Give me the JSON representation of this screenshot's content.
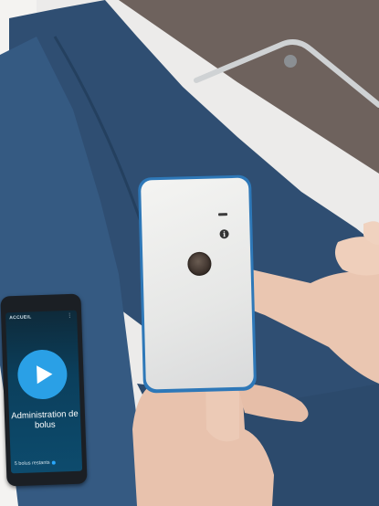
{
  "phone": {
    "header": "ACCUEIL",
    "menu_icon": "more-vertical-icon",
    "play_icon": "play-icon",
    "action_label": "Administration de bolus",
    "remaining": "5 bolus restants"
  },
  "device": {
    "info_glyph": "i",
    "button_icon": "round-push-button",
    "led": "status-led"
  },
  "colors": {
    "device_bezel": "#2e78b8",
    "phone_accent": "#2aa0e6",
    "jeans": "#2f4e72",
    "floor": "#6e625d"
  }
}
